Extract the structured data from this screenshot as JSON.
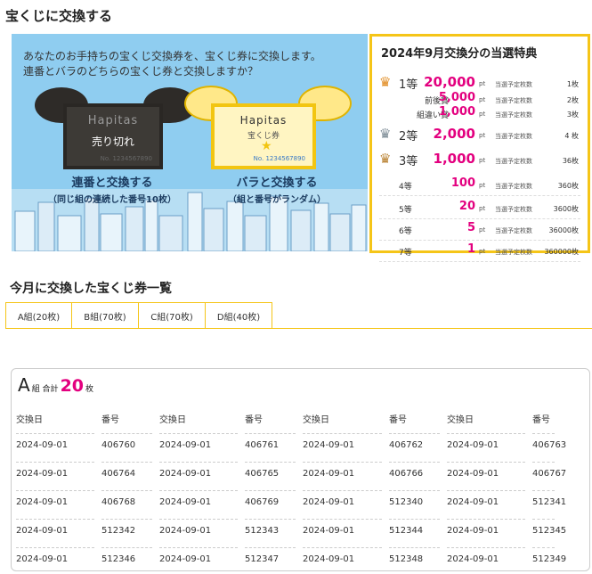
{
  "page_title": "宝くじに交換する",
  "banner": {
    "line1": "あなたのお手持ちの宝くじ交換券を、宝くじ券に交換します。",
    "line2": "連番とバラのどちらの宝くじ券と交換しますか？",
    "ticket_a": {
      "brand": "Hapitas",
      "status": "売り切れ",
      "number": "No. 1234567890"
    },
    "ticket_b": {
      "brand": "Hapitas",
      "subtitle": "宝くじ券",
      "number": "No. 1234567890"
    },
    "option_a": {
      "label": "連番と交換する",
      "desc": "（同じ組の連続した番号10枚）"
    },
    "option_b": {
      "label": "バラと交換する",
      "desc": "（組と番号がランダム）"
    }
  },
  "prize": {
    "title": "2024年9月交換分の当選特典",
    "unit": "pt",
    "count_label": "当選予定枚数",
    "rows": [
      {
        "rank": "1等",
        "style": "big",
        "crown": "gold",
        "amount": "20,000",
        "count": "1枚"
      },
      {
        "rank": "前後賞",
        "style": "sub",
        "crown": "",
        "amount": "5,000",
        "count": "2枚"
      },
      {
        "rank": "組違い賞",
        "style": "sub",
        "crown": "",
        "amount": "1,000",
        "count": "3枚"
      },
      {
        "rank": "2等",
        "style": "big",
        "crown": "silver",
        "amount": "2,000",
        "count": "4 枚"
      },
      {
        "rank": "3等",
        "style": "big",
        "crown": "bronze",
        "amount": "1,000",
        "count": "36枚"
      },
      {
        "rank": "4等",
        "style": "small",
        "crown": "",
        "amount": "100",
        "count": "360枚"
      },
      {
        "rank": "5等",
        "style": "small",
        "crown": "",
        "amount": "20",
        "count": "3600枚"
      },
      {
        "rank": "6等",
        "style": "small",
        "crown": "",
        "amount": "5",
        "count": "36000枚"
      },
      {
        "rank": "7等",
        "style": "small",
        "crown": "",
        "amount": "1",
        "count": "360000枚"
      }
    ],
    "colors": {
      "gold": "#e08a1e",
      "silver": "#7c8b95",
      "bronze": "#b98232",
      "accent": "#e3007f",
      "border": "#f5c518"
    }
  },
  "list": {
    "section_title": "今月に交換した宝くじ券一覧",
    "tabs": [
      "A組(20枚)",
      "B組(70枚)",
      "C組(70枚)",
      "D組(40枚)"
    ],
    "group": "A",
    "group_label": "組 合計",
    "total": "20",
    "unit": "枚",
    "headers": [
      "交換日",
      "番号",
      "交換日",
      "番号",
      "交換日",
      "番号",
      "交換日",
      "番号"
    ],
    "rows": [
      [
        "2024-09-01",
        "406760",
        "2024-09-01",
        "406761",
        "2024-09-01",
        "406762",
        "2024-09-01",
        "406763"
      ],
      [
        "2024-09-01",
        "406764",
        "2024-09-01",
        "406765",
        "2024-09-01",
        "406766",
        "2024-09-01",
        "406767"
      ],
      [
        "2024-09-01",
        "406768",
        "2024-09-01",
        "406769",
        "2024-09-01",
        "512340",
        "2024-09-01",
        "512341"
      ],
      [
        "2024-09-01",
        "512342",
        "2024-09-01",
        "512343",
        "2024-09-01",
        "512344",
        "2024-09-01",
        "512345"
      ],
      [
        "2024-09-01",
        "512346",
        "2024-09-01",
        "512347",
        "2024-09-01",
        "512348",
        "2024-09-01",
        "512349"
      ]
    ]
  }
}
